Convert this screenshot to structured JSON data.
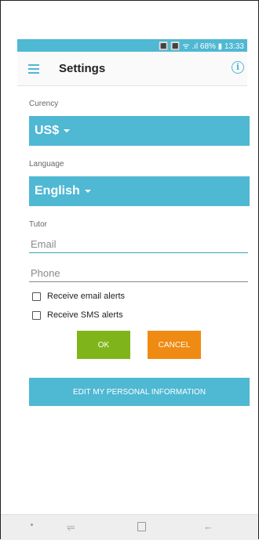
{
  "status_bar": {
    "text": "🔳 🔳 ᯤ .ıl 68% ▮ 13:33"
  },
  "app_bar": {
    "title": "Settings",
    "info_glyph": "i"
  },
  "currency": {
    "label": "Curency",
    "value": "US$"
  },
  "language": {
    "label": "Language",
    "value": "English"
  },
  "tutor": {
    "label": "Tutor",
    "email_placeholder": "Email",
    "phone_placeholder": "Phone"
  },
  "alerts": {
    "email_label": "Receive email alerts",
    "sms_label": "Receive SMS alerts"
  },
  "buttons": {
    "ok": "OK",
    "cancel": "CANCEL",
    "edit_personal": "EDIT MY PERSONAL INFORMATION"
  },
  "colors": {
    "accent": "#4fb8d3",
    "ok_green": "#7fb51a",
    "cancel_orange": "#ef8a12"
  },
  "nav_bar": {
    "recent_glyph": "⥫",
    "back_glyph": "←"
  }
}
